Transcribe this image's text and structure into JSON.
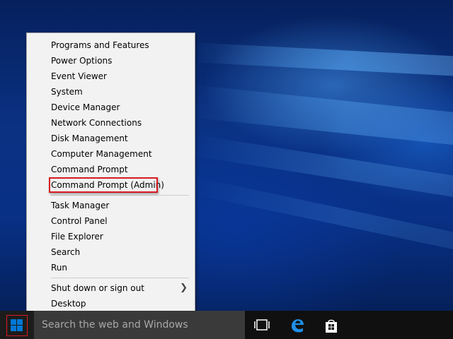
{
  "context_menu": {
    "group1": [
      {
        "label": "Programs and Features"
      },
      {
        "label": "Power Options"
      },
      {
        "label": "Event Viewer"
      },
      {
        "label": "System"
      },
      {
        "label": "Device Manager"
      },
      {
        "label": "Network Connections"
      },
      {
        "label": "Disk Management"
      },
      {
        "label": "Computer Management"
      },
      {
        "label": "Command Prompt"
      },
      {
        "label": "Command Prompt (Admin)",
        "highlighted": true
      }
    ],
    "group2": [
      {
        "label": "Task Manager"
      },
      {
        "label": "Control Panel"
      },
      {
        "label": "File Explorer"
      },
      {
        "label": "Search"
      },
      {
        "label": "Run"
      }
    ],
    "group3": [
      {
        "label": "Shut down or sign out",
        "has_submenu": true
      },
      {
        "label": "Desktop"
      }
    ],
    "highlight_color": "#d81b22"
  },
  "taskbar": {
    "search_placeholder": "Search the web and Windows",
    "icons": [
      "windows-logo-icon",
      "task-view-icon",
      "edge-icon",
      "store-icon"
    ],
    "accent_color": "#0078d7"
  }
}
